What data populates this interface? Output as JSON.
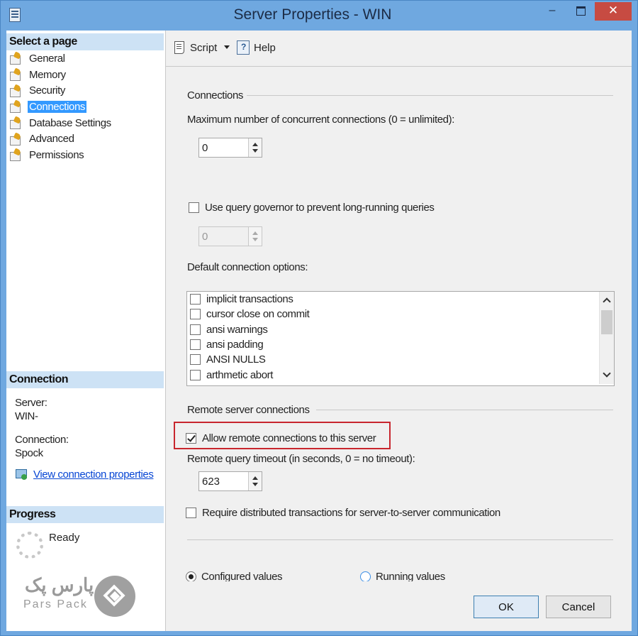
{
  "window": {
    "title": "Server Properties - WIN",
    "min_glyph": "–",
    "close_glyph": "✕"
  },
  "sidebar": {
    "select_page_label": "Select a page",
    "pages": [
      {
        "label": "General"
      },
      {
        "label": "Memory"
      },
      {
        "label": "Security"
      },
      {
        "label": "Connections",
        "selected": true
      },
      {
        "label": "Database Settings"
      },
      {
        "label": "Advanced"
      },
      {
        "label": "Permissions"
      }
    ],
    "connection_header": "Connection",
    "server_label": "Server:",
    "server_value": "WIN-",
    "connection_label": "Connection:",
    "connection_value": "Spock",
    "view_connection_link": "View connection properties",
    "progress_header": "Progress",
    "progress_status": "Ready"
  },
  "toolbar": {
    "script_label": "Script",
    "help_label": "Help"
  },
  "connections": {
    "group_title": "Connections",
    "max_connections_label": "Maximum number of concurrent connections (0 = unlimited):",
    "max_connections_value": "0",
    "query_governor_label": "Use query governor to prevent long-running queries",
    "query_governor_checked": false,
    "query_governor_value": "0",
    "default_options_label": "Default connection options:",
    "options": [
      {
        "label": "implicit transactions",
        "checked": false
      },
      {
        "label": "cursor close on commit",
        "checked": false
      },
      {
        "label": "ansi warnings",
        "checked": false
      },
      {
        "label": "ansi padding",
        "checked": false
      },
      {
        "label": "ANSI NULLS",
        "checked": false
      },
      {
        "label": "arthmetic abort",
        "checked": false
      }
    ]
  },
  "remote": {
    "group_title": "Remote server connections",
    "allow_remote_label": "Allow remote connections to this server",
    "allow_remote_checked": true,
    "timeout_label": "Remote query timeout (in seconds, 0 = no timeout):",
    "timeout_value": "623",
    "require_distributed_label": "Require distributed transactions for server-to-server communication",
    "require_distributed_checked": false
  },
  "values_mode": {
    "configured_label": "Configured values",
    "running_label": "Running values",
    "selected": "configured"
  },
  "buttons": {
    "ok_label": "OK",
    "cancel_label": "Cancel"
  },
  "watermark": {
    "persian_text": "پارس پک",
    "english_text": "Pars Pack"
  },
  "colors": {
    "title_bar": "#6fa8e0",
    "selected_page": "#3399ff",
    "highlight_box": "#c8262e",
    "close_button": "#c74b42"
  }
}
